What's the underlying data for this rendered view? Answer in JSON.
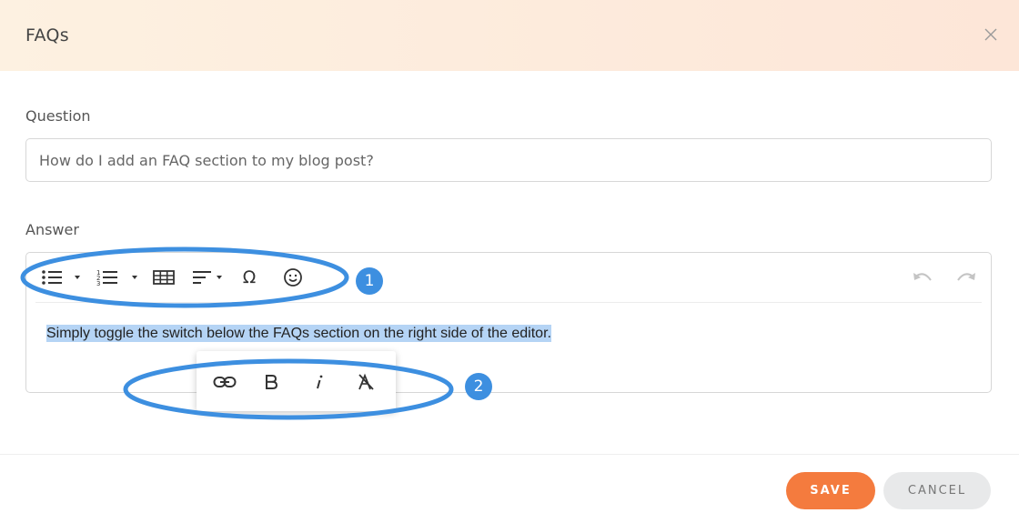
{
  "dialog": {
    "title": "FAQs",
    "close_icon": "close-icon"
  },
  "question": {
    "label": "Question",
    "value": "How do I add an FAQ section to my blog post?"
  },
  "answer": {
    "label": "Answer",
    "text": "Simply toggle the switch below the FAQs section on the right side of the editor.",
    "toolbar": [
      "bulleted-list-icon",
      "numbered-list-icon",
      "table-icon",
      "align-icon",
      "special-characters-icon",
      "emoji-icon",
      "undo-icon",
      "redo-icon"
    ],
    "inline_toolbar": [
      "link-icon",
      "bold-icon",
      "italic-icon",
      "clear-format-icon"
    ]
  },
  "annotations": {
    "badge_1": "1",
    "badge_2": "2",
    "color": "#3d8fe0"
  },
  "footer": {
    "save_label": "SAVE",
    "cancel_label": "CANCEL"
  },
  "colors": {
    "accent": "#f47b3e",
    "selection": "#b5d4f5"
  }
}
